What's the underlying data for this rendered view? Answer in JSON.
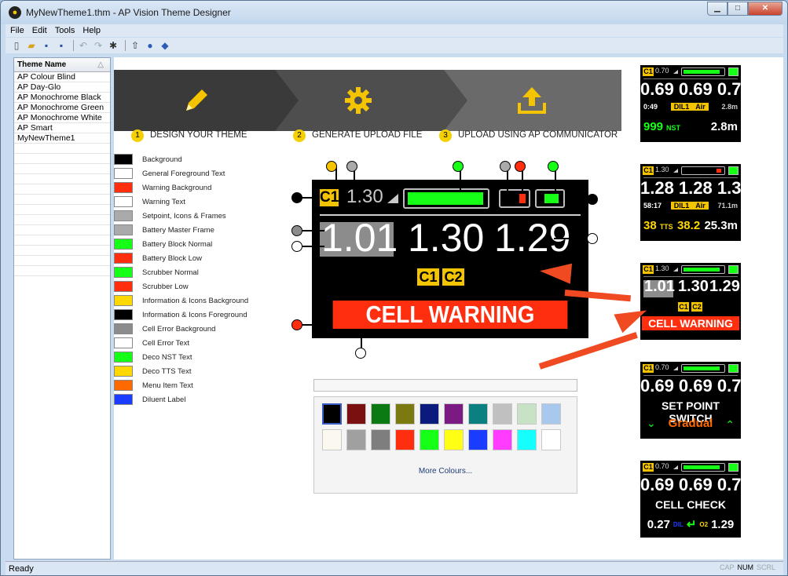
{
  "window": {
    "title": "MyNewTheme1.thm - AP Vision Theme Designer",
    "app_icon": "ap-vision-logo-icon",
    "controls": {
      "minimize": "minimize-icon",
      "maximize": "maximize-icon",
      "close": "close-icon"
    }
  },
  "menu": [
    "File",
    "Edit",
    "Tools",
    "Help"
  ],
  "toolbar": [
    "new-file-icon",
    "open-folder-icon",
    "save-icon",
    "save-as-icon",
    "undo-icon",
    "redo-icon",
    "gear-icon",
    "upload-icon",
    "help-icon",
    "palette-icon"
  ],
  "themes": {
    "header": "Theme Name",
    "items": [
      "AP Colour Blind",
      "AP Day-Glo",
      "AP Monochrome Black",
      "AP Monochrome Green",
      "AP Monochrome White",
      "AP Smart",
      "MyNewTheme1"
    ]
  },
  "steps": [
    {
      "num": "1",
      "label": "DESIGN YOUR THEME",
      "icon": "pencil-icon"
    },
    {
      "num": "2",
      "label": "GENERATE UPLOAD FILE",
      "icon": "gear-icon"
    },
    {
      "num": "3",
      "label": "UPLOAD USING AP COMMUNICATOR",
      "icon": "upload-icon"
    }
  ],
  "color_settings": [
    {
      "label": "Background",
      "color": "#000000"
    },
    {
      "label": "General Foreground Text",
      "color": "#ffffff"
    },
    {
      "label": "Warning Background",
      "color": "#ff2e0f"
    },
    {
      "label": "Warning Text",
      "color": "#ffffff"
    },
    {
      "label": "Setpoint, Icons & Frames",
      "color": "#aaaaaa"
    },
    {
      "label": "Battery Master Frame",
      "color": "#aaaaaa"
    },
    {
      "label": "Battery Block Normal",
      "color": "#16ff16"
    },
    {
      "label": "Battery Block Low",
      "color": "#ff2e0f"
    },
    {
      "label": "Scrubber Normal",
      "color": "#16ff16"
    },
    {
      "label": "Scrubber Low",
      "color": "#ff2e0f"
    },
    {
      "label": "Information & Icons Background",
      "color": "#ffd800"
    },
    {
      "label": "Information & Icons Foreground",
      "color": "#000000"
    },
    {
      "label": "Cell Error Background",
      "color": "#8c8c8c"
    },
    {
      "label": "Cell Error Text",
      "color": "#ffffff"
    },
    {
      "label": "Deco NST Text",
      "color": "#16ff16"
    },
    {
      "label": "Deco TTS Text",
      "color": "#ffd800"
    },
    {
      "label": "Menu Item Text",
      "color": "#ff6a00"
    },
    {
      "label": "Diluent Label",
      "color": "#1a3cff"
    }
  ],
  "main_display": {
    "c1": "C1",
    "setpoint": "1.30",
    "cells": [
      "1.01",
      "1.30",
      "1.29"
    ],
    "cal": [
      "C1",
      "C2"
    ],
    "warning": "CELL WARNING"
  },
  "palette": {
    "colors_row1": [
      "#000000",
      "#7b1010",
      "#0c7a12",
      "#7a7a10",
      "#0b1a7d",
      "#7a1a82",
      "#0a8080",
      "#c0c0c0",
      "#c8e2c6",
      "#a8c8ee"
    ],
    "colors_row2": [
      "#fbf9ef",
      "#a0a0a0",
      "#7e7e7e",
      "#ff2e0f",
      "#16ff16",
      "#ffff16",
      "#1a3cff",
      "#ff3cff",
      "#16ffff",
      "#ffffff"
    ],
    "more_label": "More Colours..."
  },
  "previews": [
    {
      "sp": "0.70",
      "cells": "0.69 0.69 0.70",
      "time": "0:49",
      "dil": "DIL1",
      "gas": "Air",
      "depth": "2.8m",
      "deco_val": "999",
      "deco_label": "NST",
      "deco_depth": "2.8m"
    },
    {
      "sp": "1.30",
      "cells": "1.28 1.28 1.31",
      "time": "58:17",
      "dil": "DIL1",
      "gas": "Air",
      "depth": "71.1m",
      "tts_val": "38",
      "tts_label": "TTS",
      "tts_time": "38.2",
      "tts_depth": "25.3m"
    },
    {
      "sp": "1.30",
      "cell1": "1.01",
      "cell2": "1.30",
      "cell3": "1.29",
      "cal1": "C1",
      "cal2": "C2",
      "warning": "CELL WARNING"
    },
    {
      "sp": "0.70",
      "cells": "0.69 0.69 0.70",
      "title": "SET POINT SWITCH",
      "option": "Gradual"
    },
    {
      "sp": "0.70",
      "cells": "0.69 0.69 0.70",
      "title": "CELL CHECK",
      "dil_val": "0.27",
      "dil_label": "DIL",
      "o2_label": "O2",
      "o2_val": "1.29"
    }
  ],
  "preview_badge": "C1",
  "status": {
    "text": "Ready",
    "indicators": [
      "CAP",
      "NUM",
      "SCRL"
    ]
  }
}
